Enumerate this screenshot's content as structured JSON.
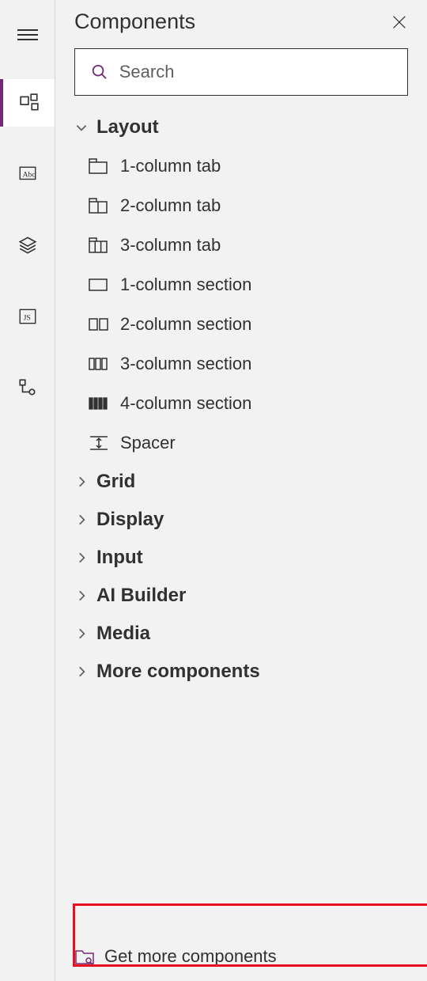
{
  "panel": {
    "title": "Components",
    "search_placeholder": "Search"
  },
  "categories": [
    {
      "label": "Layout",
      "expanded": true
    },
    {
      "label": "Grid",
      "expanded": false
    },
    {
      "label": "Display",
      "expanded": false
    },
    {
      "label": "Input",
      "expanded": false
    },
    {
      "label": "AI Builder",
      "expanded": false
    },
    {
      "label": "Media",
      "expanded": false
    },
    {
      "label": "More components",
      "expanded": false
    }
  ],
  "layout_items": [
    {
      "label": "1-column tab",
      "icon": "tab-1col"
    },
    {
      "label": "2-column tab",
      "icon": "tab-2col"
    },
    {
      "label": "3-column tab",
      "icon": "tab-3col"
    },
    {
      "label": "1-column section",
      "icon": "section-1col"
    },
    {
      "label": "2-column section",
      "icon": "section-2col"
    },
    {
      "label": "3-column section",
      "icon": "section-3col"
    },
    {
      "label": "4-column section",
      "icon": "section-4col"
    },
    {
      "label": "Spacer",
      "icon": "spacer"
    }
  ],
  "footer": {
    "label": "Get more components"
  },
  "colors": {
    "accent": "#742774",
    "highlight": "#e81123"
  }
}
